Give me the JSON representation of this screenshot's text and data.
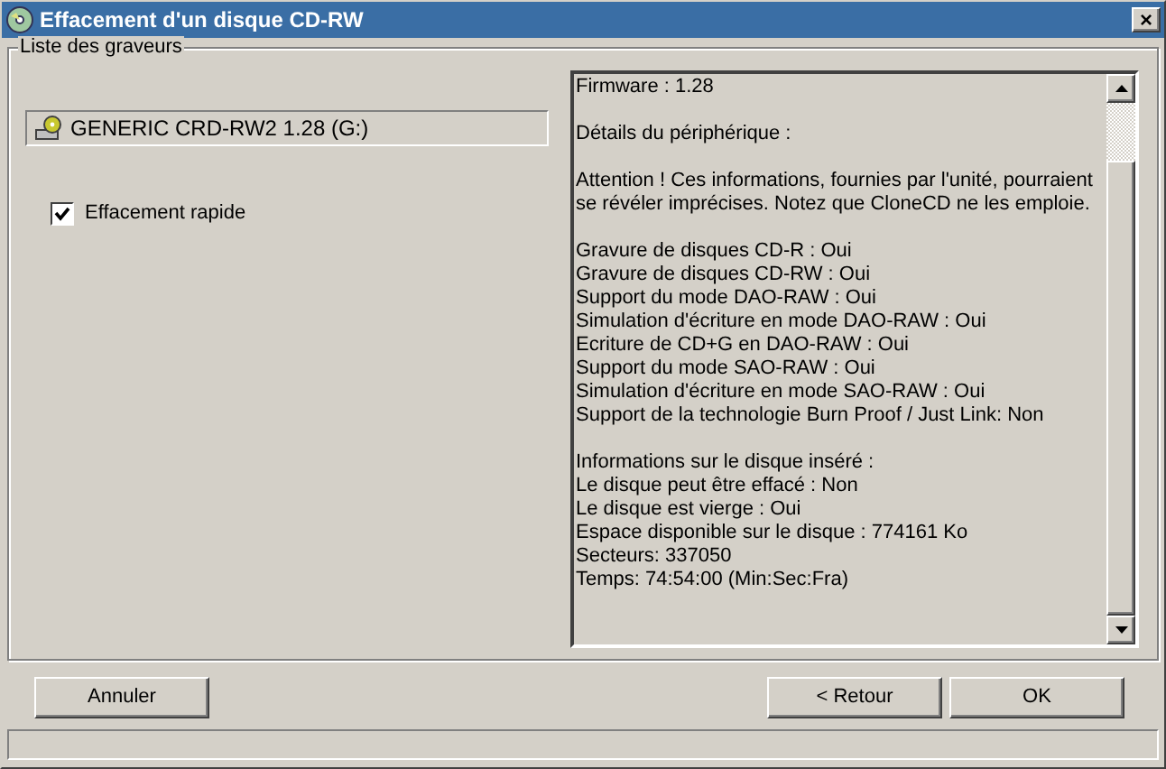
{
  "window": {
    "title": "Effacement d'un disque CD-RW"
  },
  "group": {
    "title": "Liste des graveurs"
  },
  "recorder": {
    "label": "GENERIC CRD-RW2 1.28 (G:)"
  },
  "options": [
    {
      "label": "Effacement rapide",
      "checked": true
    }
  ],
  "details": [
    {
      "lines": [
        "Firmware : 1.28"
      ]
    },
    {
      "lines": [
        "Détails du périphérique :"
      ]
    },
    {
      "lines": [
        "Attention ! Ces informations, fournies par l'unité, pourraient se révéler imprécises. Notez que CloneCD ne les emploie."
      ]
    },
    {
      "lines": [
        "Gravure de disques CD-R : Oui",
        "Gravure de disques CD-RW : Oui",
        "Support du mode DAO-RAW : Oui",
        "Simulation d'écriture en mode DAO-RAW : Oui",
        "Ecriture de CD+G en DAO-RAW : Oui",
        "Support du mode SAO-RAW : Oui",
        "Simulation d'écriture en mode SAO-RAW : Oui",
        "Support de la technologie Burn Proof / Just Link: Non"
      ]
    },
    {
      "lines": [
        "Informations sur le disque inséré :",
        "Le disque peut être effacé : Non",
        "Le disque est vierge : Oui",
        "Espace disponible sur le disque : 774161 Ko",
        "Secteurs: 337050",
        "Temps: 74:54:00 (Min:Sec:Fra)"
      ]
    }
  ],
  "buttons": {
    "left": [
      "Annuler"
    ],
    "right": [
      "< Retour",
      "OK"
    ]
  },
  "close_button": "×"
}
